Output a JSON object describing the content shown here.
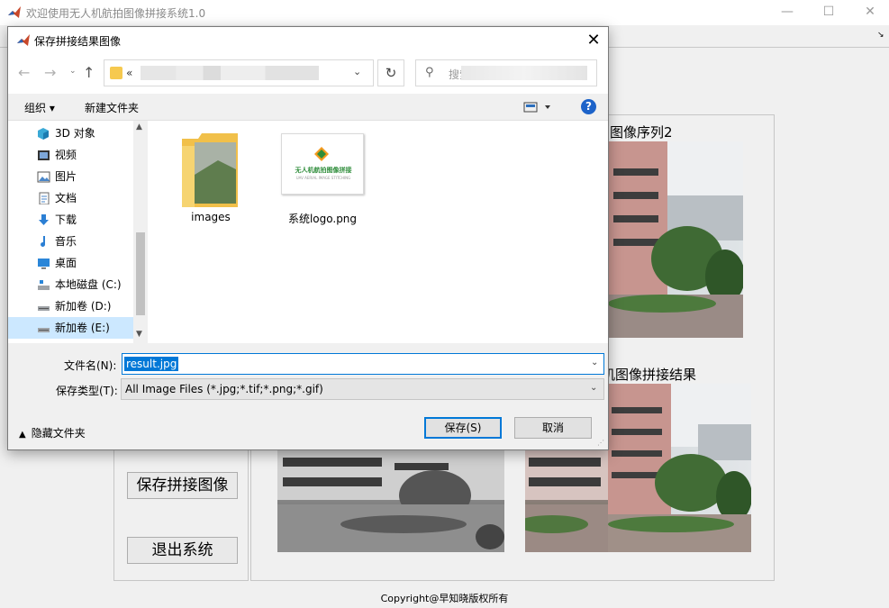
{
  "app": {
    "title": "欢迎使用无人机航拍图像拼接系统1.0",
    "minimize": "—",
    "maximize": "☐",
    "close": "✕",
    "toolbar_arrow": "↘",
    "labels": {
      "seq2": "图像序列2",
      "result": "机图像拼接结果"
    },
    "buttons": {
      "save_stitched": "保存拼接图像",
      "exit": "退出系统"
    },
    "copyright": "Copyright@早知晓版权所有"
  },
  "dialog": {
    "title": "保存拼接结果图像",
    "close": "✕",
    "nav": {
      "back": "←",
      "forward": "→",
      "recent": "⌄",
      "up": "↑",
      "path_prefix": "«",
      "path_chevron": "⌄",
      "refresh": "↻",
      "search_icon": "⚲",
      "search_placeholder": "搜索"
    },
    "commands": {
      "organize": "组织 ▾",
      "new_folder": "新建文件夹",
      "help": "?"
    },
    "tree": [
      {
        "label": "3D 对象",
        "icon": "cube-3d-icon",
        "selected": false
      },
      {
        "label": "视频",
        "icon": "video-icon",
        "selected": false
      },
      {
        "label": "图片",
        "icon": "picture-icon",
        "selected": false
      },
      {
        "label": "文档",
        "icon": "document-icon",
        "selected": false
      },
      {
        "label": "下载",
        "icon": "download-icon",
        "selected": false
      },
      {
        "label": "音乐",
        "icon": "music-icon",
        "selected": false
      },
      {
        "label": "桌面",
        "icon": "desktop-icon",
        "selected": false
      },
      {
        "label": "本地磁盘 (C:)",
        "icon": "system-drive-icon",
        "selected": false
      },
      {
        "label": "新加卷 (D:)",
        "icon": "drive-icon",
        "selected": false
      },
      {
        "label": "新加卷 (E:)",
        "icon": "drive-icon",
        "selected": true
      }
    ],
    "files": {
      "folder_name": "images",
      "png_name": "系统logo.png",
      "logo_text": "无人机航拍图像拼接",
      "logo_subtext": "UAV AERIAL IMAGE STITCHING"
    },
    "fields": {
      "filename_label": "文件名(N):",
      "filename_value": "result.jpg",
      "filetype_label": "保存类型(T):",
      "filetype_value": "All Image Files (*.jpg;*.tif;*.png;*.gif)"
    },
    "footer": {
      "hide_folders": "隐藏文件夹",
      "save": "保存(S)",
      "cancel": "取消"
    }
  },
  "colors": {
    "accent": "#0078d7",
    "folder": "#f6c94f",
    "logo_green": "#2f8d3b",
    "help_blue": "#1d63c9"
  }
}
